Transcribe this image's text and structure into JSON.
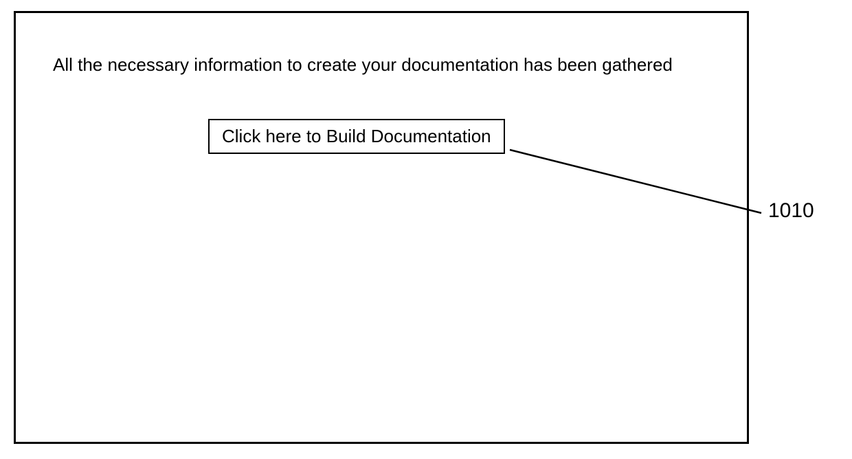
{
  "panel": {
    "message": "All the necessary information to create your documentation has been gathered",
    "build_button_label": "Click here to Build Documentation"
  },
  "callout": {
    "ref_number": "1010"
  }
}
